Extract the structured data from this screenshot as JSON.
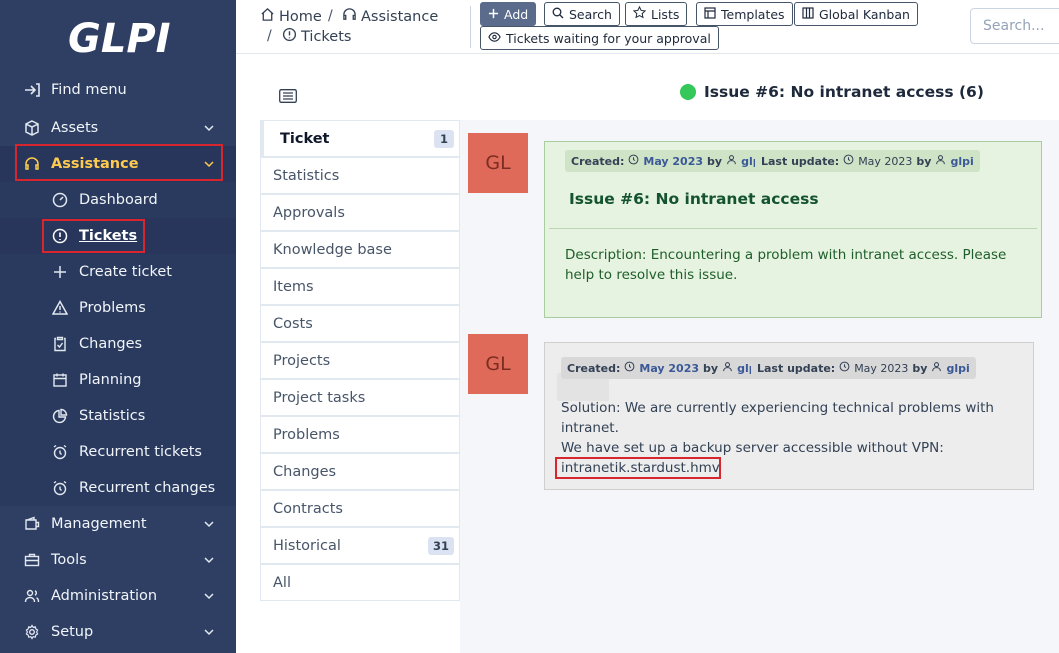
{
  "app": {
    "logo_text": "GLPI"
  },
  "sidebar": {
    "items": [
      {
        "label": "Find menu",
        "icon": "arrow-right-icon"
      },
      {
        "label": "Assets",
        "icon": "box-icon"
      },
      {
        "label": "Assistance",
        "icon": "headset-icon"
      },
      {
        "label": "Management",
        "icon": "wallet-icon"
      },
      {
        "label": "Tools",
        "icon": "briefcase-icon"
      },
      {
        "label": "Administration",
        "icon": "users-icon"
      },
      {
        "label": "Setup",
        "icon": "gear-icon"
      }
    ],
    "sub_items": [
      {
        "label": "Dashboard",
        "icon": "gauge-icon"
      },
      {
        "label": "Tickets",
        "icon": "alert-circle-icon"
      },
      {
        "label": "Create ticket",
        "icon": "plus-icon"
      },
      {
        "label": "Problems",
        "icon": "warning-triangle-icon"
      },
      {
        "label": "Changes",
        "icon": "clipboard-check-icon"
      },
      {
        "label": "Planning",
        "icon": "calendar-icon"
      },
      {
        "label": "Statistics",
        "icon": "chart-pie-icon"
      },
      {
        "label": "Recurrent tickets",
        "icon": "alarm-icon"
      },
      {
        "label": "Recurrent changes",
        "icon": "alarm-icon"
      }
    ]
  },
  "header": {
    "breadcrumb": [
      "Home",
      "Assistance",
      "Tickets"
    ],
    "buttons": {
      "add": "Add",
      "search": "Search",
      "lists": "Lists",
      "templates": "Templates",
      "kanban": "Global Kanban",
      "approval": "Tickets waiting for your approval"
    },
    "search_placeholder": "Search..."
  },
  "main": {
    "title": "Issue #6: No intranet access (6)",
    "status_color": "#34c759",
    "tabs": [
      {
        "label": "Ticket",
        "count": "1"
      },
      {
        "label": "Statistics"
      },
      {
        "label": "Approvals"
      },
      {
        "label": "Knowledge base"
      },
      {
        "label": "Items"
      },
      {
        "label": "Costs"
      },
      {
        "label": "Projects"
      },
      {
        "label": "Project tasks"
      },
      {
        "label": "Problems"
      },
      {
        "label": "Changes"
      },
      {
        "label": "Contracts"
      },
      {
        "label": "Historical",
        "count": "31"
      },
      {
        "label": "All"
      }
    ],
    "timeline": [
      {
        "avatar": "GL",
        "created_label": "Created:",
        "created_date": "May 2023",
        "by": "by",
        "author": "glpi",
        "updated_label": "Last update:",
        "updated_date": "May 2023",
        "updated_author": "glpi",
        "title": "Issue #6: No intranet access",
        "description": "Description: Encountering a problem with intranet access. Please help to resolve this issue."
      },
      {
        "avatar": "GL",
        "created_label": "Created:",
        "created_date": "May 2023",
        "by": "by",
        "author": "glpi",
        "updated_label": "Last update:",
        "updated_date": "May 2023",
        "updated_author": "glpi",
        "solution_line1": "Solution: We are currently experiencing technical problems with intranet.",
        "solution_line2": "We have set up a backup server accessible without VPN:",
        "solution_link": "intranetik.stardust.hmv"
      }
    ]
  }
}
